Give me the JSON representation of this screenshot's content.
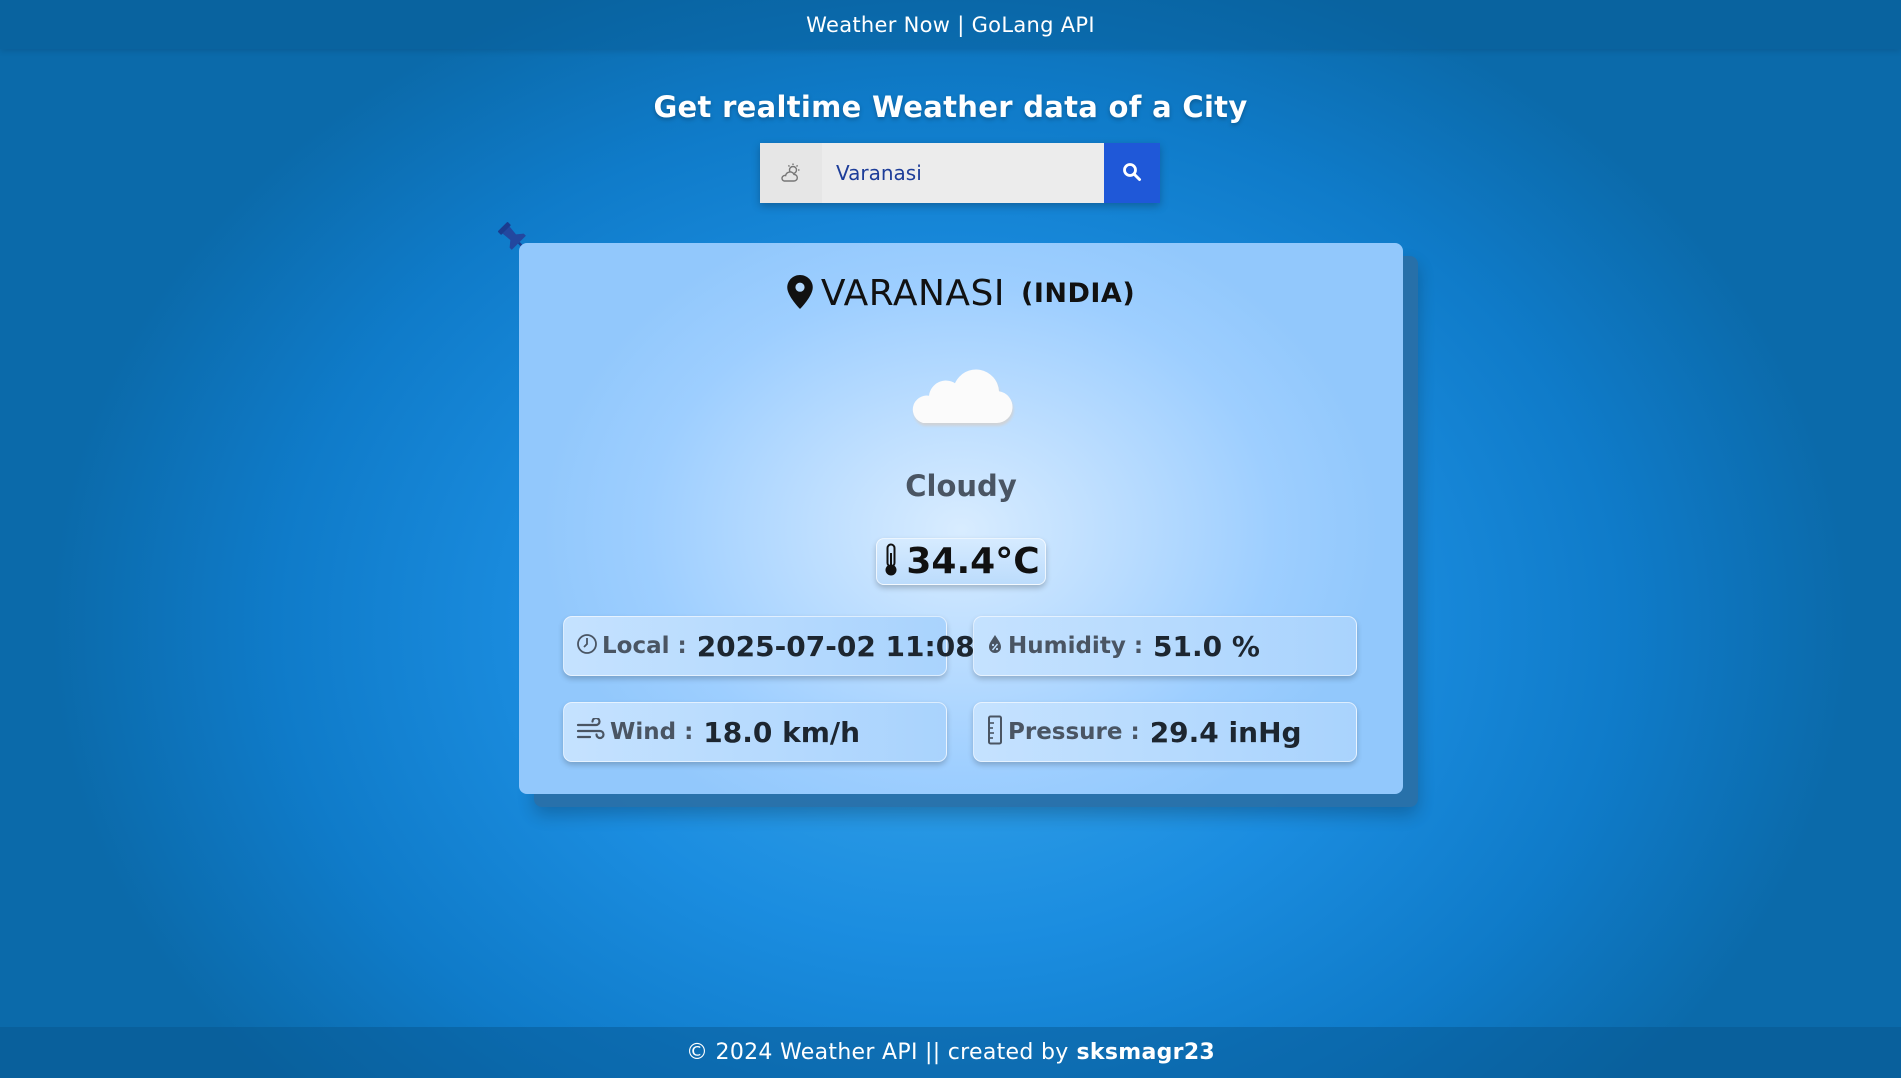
{
  "header": {
    "title": "Weather Now | GoLang API"
  },
  "main": {
    "heading": "Get realtime Weather data of a City"
  },
  "search": {
    "value": "Varanasi",
    "icon": "partly-cloudy-icon",
    "button_icon": "search-icon"
  },
  "weather": {
    "city": "VARANASI",
    "country": "(INDIA)",
    "condition": "Cloudy",
    "condition_icon": "cloud-icon",
    "temperature": "34.4°C",
    "details": {
      "local_label": "Local",
      "local_value": "2025-07-02 11:08",
      "humidity_label": "Humidity",
      "humidity_value": "51.0 %",
      "wind_label": "Wind",
      "wind_value": "18.0 km/h",
      "pressure_label": "Pressure",
      "pressure_value": "29.4 inHg",
      "colon": ":"
    }
  },
  "footer": {
    "text": "© 2024 Weather API || created by",
    "author": "sksmagr23"
  },
  "colors": {
    "accent": "#1f58d8",
    "card": "#a9d3fd",
    "background": "#1b8de0"
  }
}
